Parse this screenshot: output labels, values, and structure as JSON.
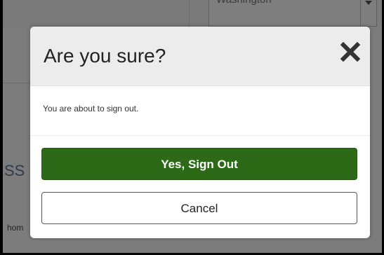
{
  "background": {
    "select_value": "Washington",
    "heading_fragment": "SS",
    "text_fragment": "hom"
  },
  "dialog": {
    "title": "Are you sure?",
    "close_icon": "close-icon",
    "message": "You are about to sign out.",
    "confirm_label": "Yes, Sign Out",
    "cancel_label": "Cancel"
  },
  "colors": {
    "primary": "#2c6a17",
    "overlay": "#7c7c7c",
    "header_bg": "#ececec"
  }
}
